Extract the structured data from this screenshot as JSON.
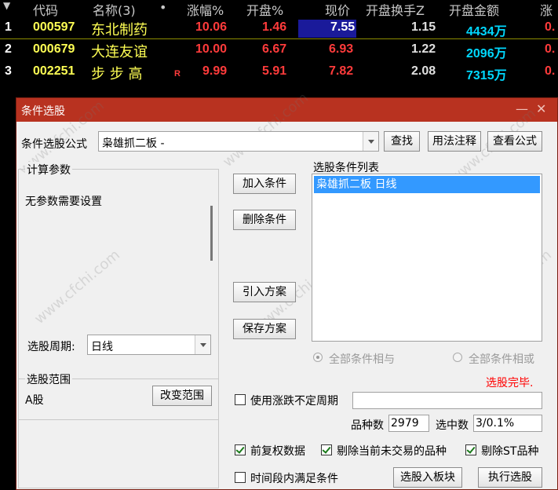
{
  "table": {
    "headers": {
      "code": "代码",
      "name": "名称(3)",
      "dot": "•",
      "change_pct": "涨幅%",
      "open_pct": "开盘%",
      "price": "现价",
      "open_turnover": "开盘换手Z",
      "open_amount": "开盘金额",
      "cut": "涨"
    },
    "rows": [
      {
        "idx": "1",
        "code": "000597",
        "name": "东北制药",
        "flag": "",
        "change": "10.06",
        "open": "1.46",
        "price": "7.55",
        "turnover": "1.15",
        "amount": "4434万",
        "tail": "0."
      },
      {
        "idx": "2",
        "code": "000679",
        "name": "大连友谊",
        "flag": "",
        "change": "10.00",
        "open": "6.67",
        "price": "6.93",
        "turnover": "1.22",
        "amount": "2096万",
        "tail": "0."
      },
      {
        "idx": "3",
        "code": "002251",
        "name": "步 步 高",
        "flag": "R",
        "change": "9.99",
        "open": "5.91",
        "price": "7.82",
        "turnover": "2.08",
        "amount": "7315万",
        "tail": "0."
      }
    ]
  },
  "dialog": {
    "title": "条件选股",
    "minimize": "—",
    "close": "✕",
    "formula_label": "条件选股公式",
    "formula_value": "枭雄抓二板  -",
    "find_button": "查找",
    "usage_button": "用法注释",
    "view_formula_button": "查看公式",
    "params_group": "计算参数",
    "params_text": "无参数需要设置",
    "add_button": "加入条件",
    "delete_button": "删除条件",
    "import_button": "引入方案",
    "save_button": "保存方案",
    "cond_list_label": "选股条件列表",
    "cond_items": [
      "枭雄抓二板  日线"
    ],
    "period_label": "选股周期:",
    "period_value": "日线",
    "radio_and": "全部条件相与",
    "radio_or": "全部条件相或",
    "status": "选股完毕.",
    "range_group": "选股范围",
    "range_value": "A股",
    "change_range_button": "改变范围",
    "variable_period": "使用涨跌不定周期",
    "variable_period_value": "",
    "count_label": "品种数",
    "count_value": "2979",
    "selected_label": "选中数",
    "selected_value": "3/0.1%",
    "adjusted_data": "前复权数据",
    "exclude_untraded": "剔除当前未交易的品种",
    "exclude_st": "剔除ST品种",
    "time_period": "时间段内满足条件",
    "to_board_button": "选股入板块",
    "execute_button": "执行选股",
    "watermark": "www.cfchi.com"
  },
  "colors": {
    "code": "#ffff54",
    "name": "#ffff54",
    "red": "#ff3b3b",
    "turnover": "#e0e0e0",
    "amount": "#00d8ff",
    "title_bar": "#b83220",
    "selection": "#3399ff",
    "status": "#ff0000"
  }
}
